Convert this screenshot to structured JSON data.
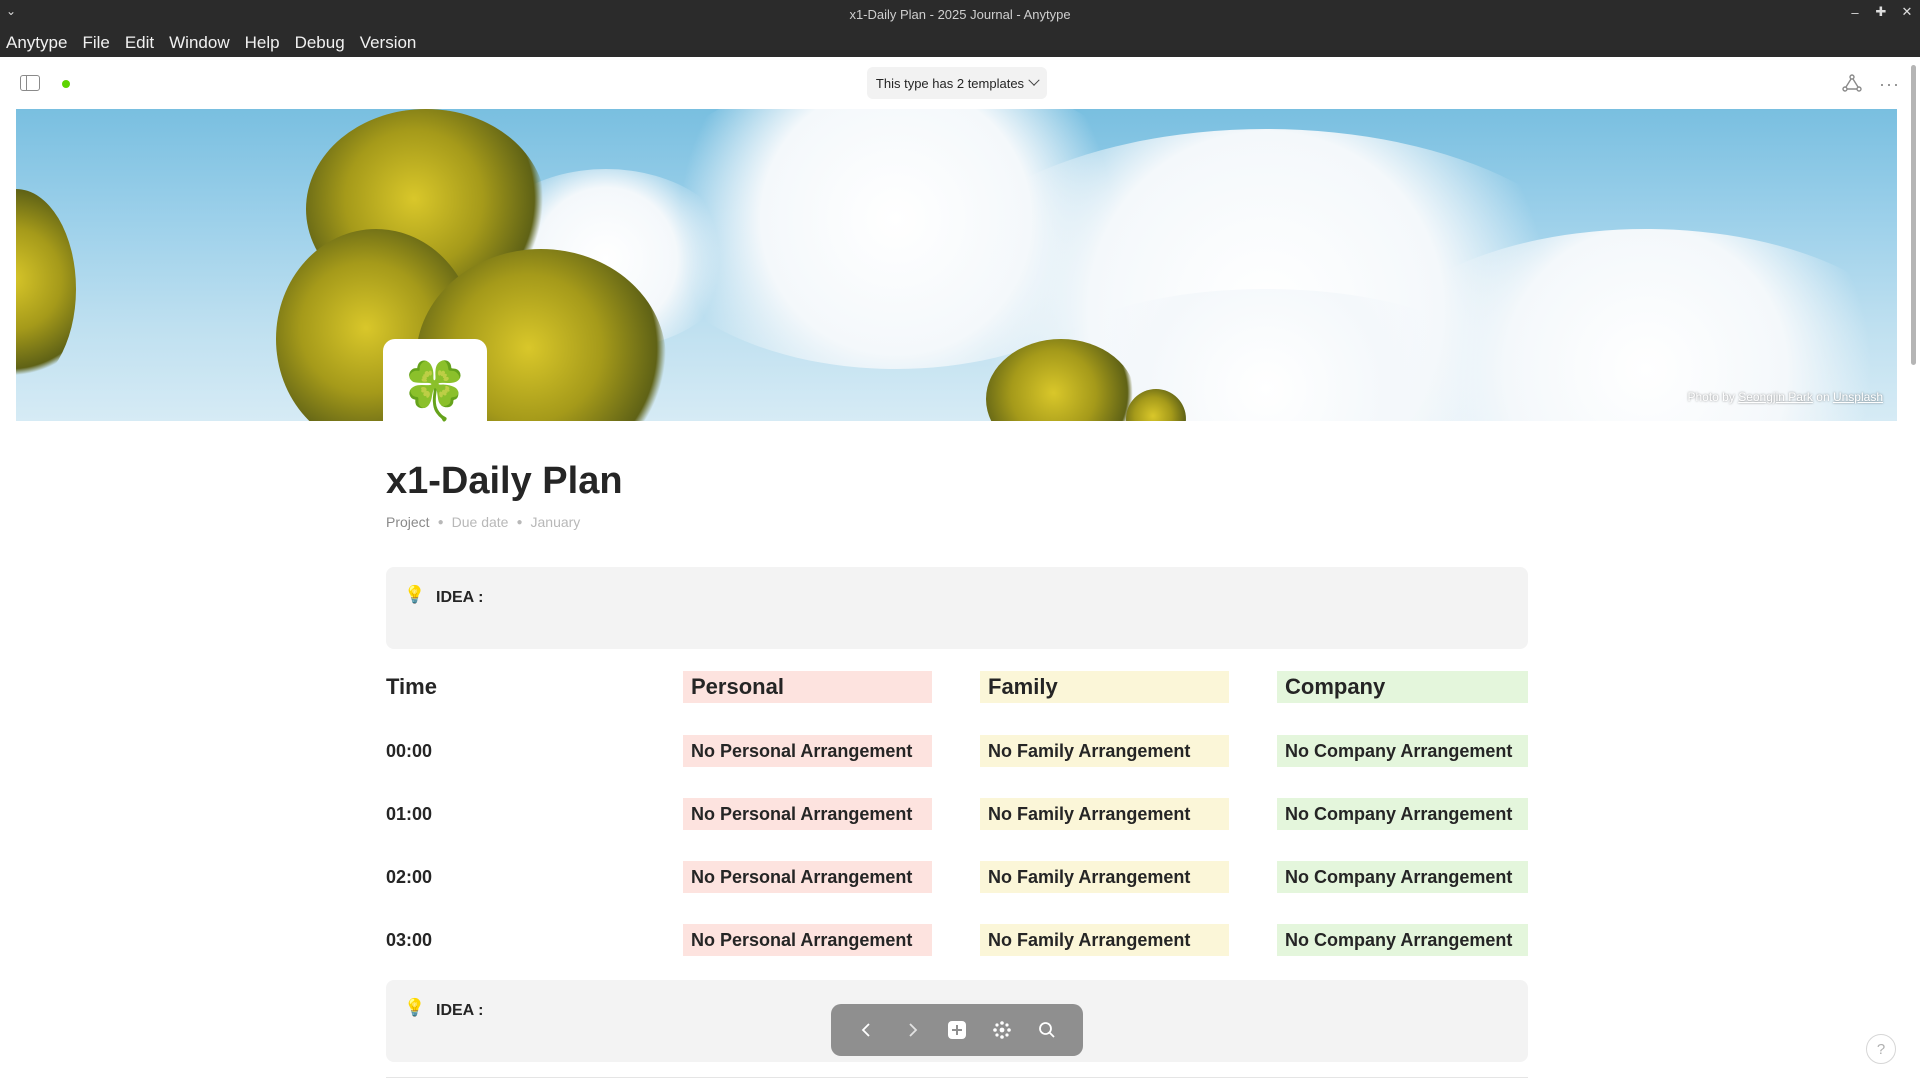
{
  "window": {
    "title": "x1-Daily Plan - 2025 Journal - Anytype",
    "controls": [
      "minimize",
      "maximize",
      "close"
    ]
  },
  "menubar": {
    "items": [
      "Anytype",
      "File",
      "Edit",
      "Window",
      "Help",
      "Debug",
      "Version"
    ]
  },
  "header": {
    "template_button": "This type has 2 templates",
    "sync_status_color": "#5dd400"
  },
  "cover": {
    "credit_prefix": "Photo by",
    "credit_author": "Seongjin Park",
    "credit_on": "on",
    "credit_source": "Unsplash"
  },
  "page": {
    "icon": "🍀",
    "title": "x1-Daily Plan",
    "featured": {
      "type": "Project",
      "due_date": "Due date",
      "month": "January"
    }
  },
  "callouts": [
    {
      "icon": "💡",
      "label": "IDEA :"
    },
    {
      "icon": "💡",
      "label": "IDEA :"
    }
  ],
  "table": {
    "headers": {
      "time": "Time",
      "personal": "Personal",
      "family": "Family",
      "company": "Company"
    },
    "rows": [
      {
        "time": "00:00",
        "personal": "No Personal Arrangement",
        "family": "No Family Arrangement",
        "company": "No Company Arrangement"
      },
      {
        "time": "01:00",
        "personal": "No Personal Arrangement",
        "family": "No Family Arrangement",
        "company": "No Company Arrangement"
      },
      {
        "time": "02:00",
        "personal": "No Personal Arrangement",
        "family": "No Family Arrangement",
        "company": "No Company Arrangement"
      },
      {
        "time": "03:00",
        "personal": "No Personal Arrangement",
        "family": "No Family Arrangement",
        "company": "No Company Arrangement"
      }
    ],
    "colors": {
      "personal": "#fde3df",
      "family": "#fbf6d8",
      "company": "#e4f6dc"
    }
  },
  "navbar": {
    "buttons": [
      "back-icon",
      "forward-icon",
      "plus-icon",
      "graph-icon",
      "search-icon"
    ]
  },
  "help": {
    "label": "?"
  }
}
